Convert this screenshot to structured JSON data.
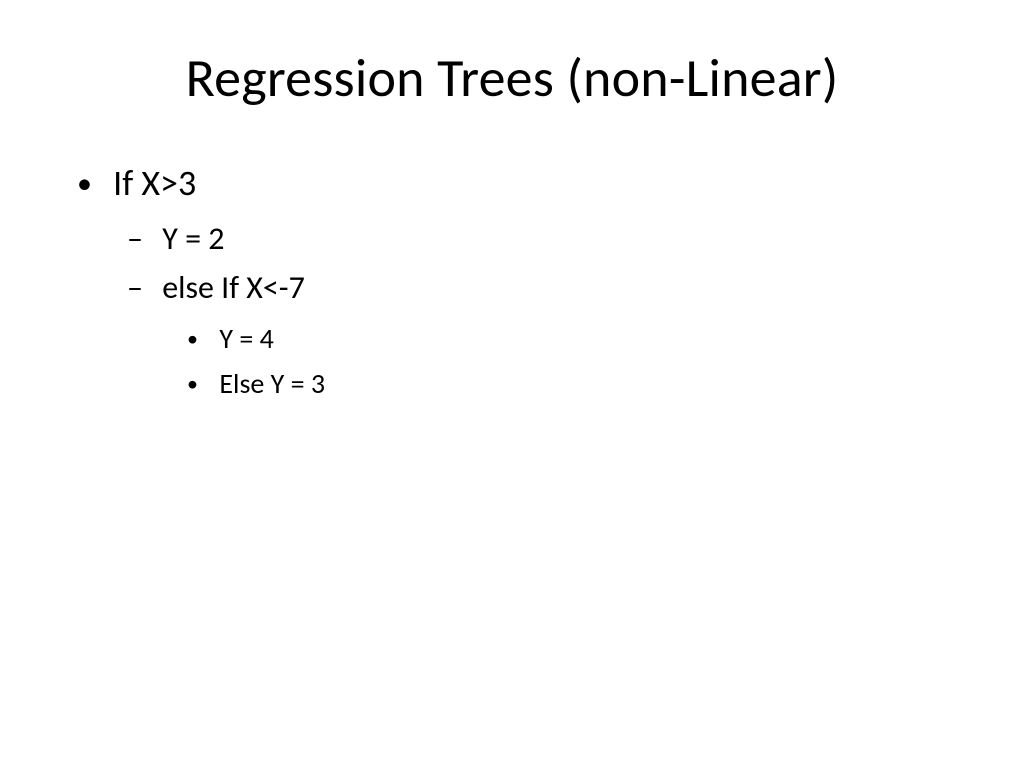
{
  "slide": {
    "title": "Regression Trees (non-Linear)",
    "lvl1": {
      "item0": "If X>3"
    },
    "lvl2": {
      "item0": "Y = 2",
      "item1": "else If X<-7"
    },
    "lvl3": {
      "item0": "Y = 4",
      "item1": "Else Y = 3"
    }
  }
}
